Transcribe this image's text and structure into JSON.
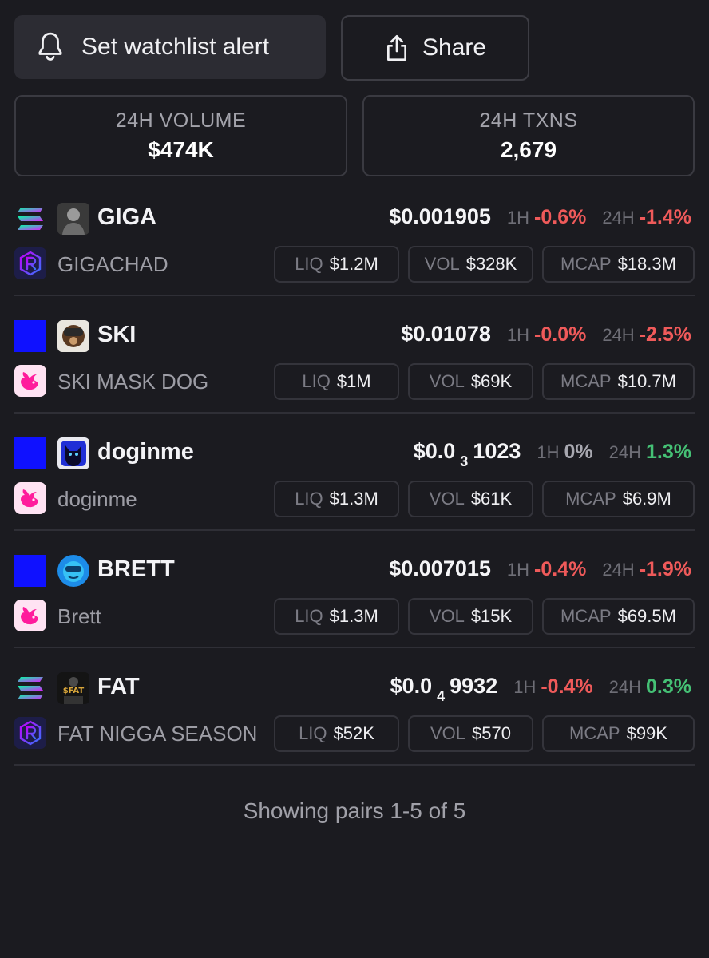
{
  "actions": {
    "alert_label": "Set watchlist alert",
    "share_label": "Share"
  },
  "stats": {
    "volume_label": "24H VOLUME",
    "volume_value": "$474K",
    "txns_label": "24H TXNS",
    "txns_value": "2,679"
  },
  "labels": {
    "h1": "1H",
    "h24": "24H",
    "liq": "LIQ",
    "vol": "VOL",
    "mcap": "MCAP"
  },
  "colors": {
    "negative": "#ef5a5a",
    "positive": "#45c175",
    "neutral": "#a8a8b0"
  },
  "pairs": [
    {
      "symbol": "GIGA",
      "name": "GIGACHAD",
      "chain_icon": "solana-icon",
      "dex_icon": "raydium-icon",
      "price_main": "$0.001905",
      "price_sub": "",
      "price_tail": "",
      "change_1h": "-0.6%",
      "change_24h": "-1.4%",
      "liq": "$1.2M",
      "vol": "$328K",
      "mcap": "$18.3M"
    },
    {
      "symbol": "SKI",
      "name": "SKI MASK DOG",
      "chain_icon": "base-icon",
      "dex_icon": "uniswap-icon",
      "price_main": "$0.01078",
      "price_sub": "",
      "price_tail": "",
      "change_1h": "-0.0%",
      "change_24h": "-2.5%",
      "liq": "$1M",
      "vol": "$69K",
      "mcap": "$10.7M"
    },
    {
      "symbol": "doginme",
      "name": "doginme",
      "chain_icon": "base-icon",
      "dex_icon": "uniswap-icon",
      "price_main": "$0.0",
      "price_sub": "3",
      "price_tail": "1023",
      "change_1h": "0%",
      "change_24h": "1.3%",
      "liq": "$1.3M",
      "vol": "$61K",
      "mcap": "$6.9M"
    },
    {
      "symbol": "BRETT",
      "name": "Brett",
      "chain_icon": "base-icon",
      "dex_icon": "uniswap-icon",
      "price_main": "$0.007015",
      "price_sub": "",
      "price_tail": "",
      "change_1h": "-0.4%",
      "change_24h": "-1.9%",
      "liq": "$1.3M",
      "vol": "$15K",
      "mcap": "$69.5M"
    },
    {
      "symbol": "FAT",
      "name": "FAT NIGGA SEASON",
      "chain_icon": "solana-icon",
      "dex_icon": "raydium-icon",
      "price_main": "$0.0",
      "price_sub": "4",
      "price_tail": "9932",
      "change_1h": "-0.4%",
      "change_24h": "0.3%",
      "liq": "$52K",
      "vol": "$570",
      "mcap": "$99K"
    }
  ],
  "footer": "Showing pairs 1-5 of 5"
}
